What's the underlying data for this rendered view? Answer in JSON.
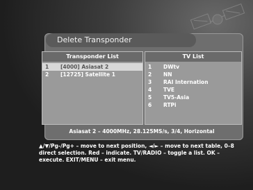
{
  "dialog": {
    "title": "Delete Transponder"
  },
  "transponder_list": {
    "header": "Transponder List",
    "items": [
      {
        "num": "1",
        "label": "[4000] Asiasat 2",
        "selected": true
      },
      {
        "num": "2",
        "label": "[12725] Satellite 1",
        "selected": false
      }
    ]
  },
  "tv_list": {
    "header": "TV List",
    "items": [
      {
        "num": "1",
        "label": "DWtv"
      },
      {
        "num": "2",
        "label": "NN"
      },
      {
        "num": "3",
        "label": "RAI Internation"
      },
      {
        "num": "4",
        "label": "TVE"
      },
      {
        "num": "5",
        "label": "TV5-Asia"
      },
      {
        "num": "6",
        "label": "RTPi"
      }
    ]
  },
  "status": {
    "text": "Asiasat 2 – 4000MHz, 28.125MS/s, 3/4, Horizontal"
  },
  "help": {
    "text": "▲/▼/Pg-/Pg+ – move to next position, ◄/► – move to next table, 0–8 direct selection. Red – indicate. TV/RADIO – toggle a list. OK – execute. EXIT/MENU – exit menu."
  },
  "colors": {
    "panel": "#9a9a9a",
    "header": "#6a6a6a",
    "selected_row": "#d8d8d8"
  }
}
